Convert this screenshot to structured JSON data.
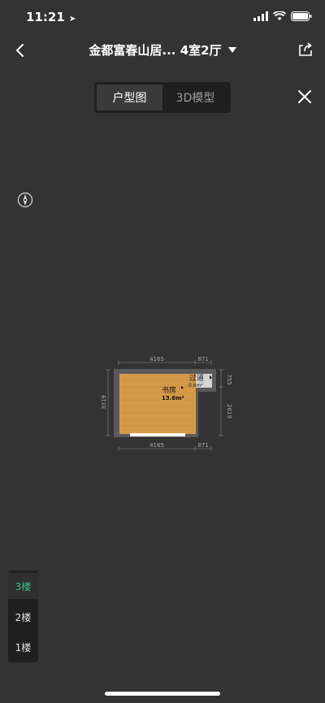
{
  "status": {
    "time": "11:21"
  },
  "header": {
    "title": "金都富春山居... 4室2厅"
  },
  "tabs": [
    {
      "label": "户型图",
      "active": true
    },
    {
      "label": "3D模型",
      "active": false
    }
  ],
  "plan": {
    "dims": {
      "top_left": "4165",
      "top_right": "871",
      "bottom_left": "4165",
      "bottom_right": "871",
      "left": "3319",
      "right_upper": "755",
      "right_lower": "2619"
    },
    "rooms": [
      {
        "name": "书房",
        "area": "13.6m²"
      },
      {
        "name": "过道",
        "area": "0.6m²"
      }
    ]
  },
  "floors": [
    {
      "label": "3楼",
      "active": true
    },
    {
      "label": "2楼",
      "active": false
    },
    {
      "label": "1楼",
      "active": false
    }
  ],
  "colors": {
    "accent": "#3dbf84",
    "background": "#333333",
    "floor": "#d49a4a"
  }
}
